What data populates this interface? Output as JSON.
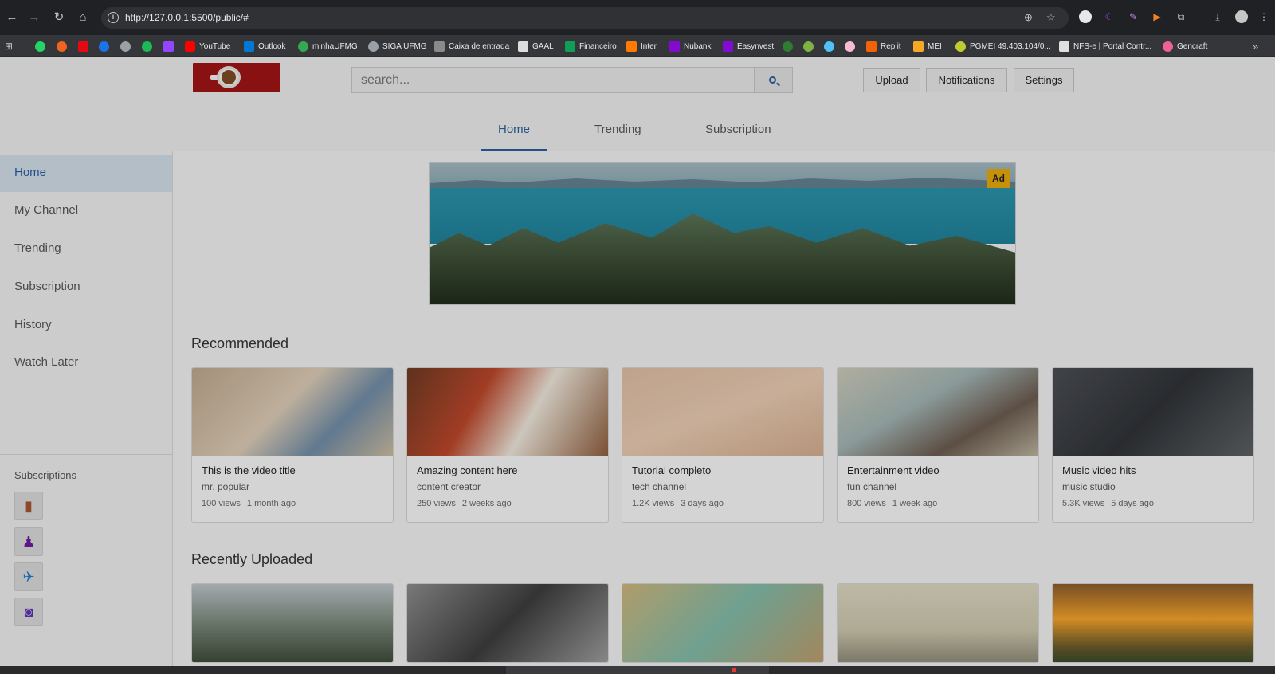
{
  "browser": {
    "url": "http://127.0.0.1:5500/public/#",
    "bookmarks": [
      "YouTube",
      "Outlook",
      "minhaUFMG",
      "SIGA UFMG",
      "Caixa de entrada",
      "GAAL",
      "Financeiro",
      "Inter",
      "Nubank",
      "Easynvest",
      "Replit",
      "MEI",
      "PGMEI 49.403.104/0...",
      "NFS-e | Portal Contr...",
      "Gencraft"
    ],
    "more": "»"
  },
  "header": {
    "search_placeholder": "search...",
    "upload_label": "Upload",
    "notifications_label": "Notifications",
    "settings_label": "Settings"
  },
  "tabs": [
    "Home",
    "Trending",
    "Subscription"
  ],
  "sidebar": {
    "items": [
      "Home",
      "My Channel",
      "Trending",
      "Subscription",
      "History",
      "Watch Later"
    ],
    "subscriptions_title": "Subscriptions"
  },
  "ad": {
    "badge": "Ad"
  },
  "sections": {
    "recommended": "Recommended",
    "recently_uploaded": "Recently Uploaded"
  },
  "recommended_videos": [
    {
      "title": "This is the video title",
      "channel": "mr. popular",
      "views": "100 views",
      "age": "1 month ago"
    },
    {
      "title": "Amazing content here",
      "channel": "content creator",
      "views": "250 views",
      "age": "2 weeks ago"
    },
    {
      "title": "Tutorial completo",
      "channel": "tech channel",
      "views": "1.2K views",
      "age": "3 days ago"
    },
    {
      "title": "Entertainment video",
      "channel": "fun channel",
      "views": "800 views",
      "age": "1 week ago"
    },
    {
      "title": "Music video hits",
      "channel": "music studio",
      "views": "5.3K views",
      "age": "5 days ago"
    }
  ],
  "colors": {
    "accent": "#2a5d9a",
    "ad_badge": "#e2a50b",
    "active_side": "#cdd9e3"
  }
}
